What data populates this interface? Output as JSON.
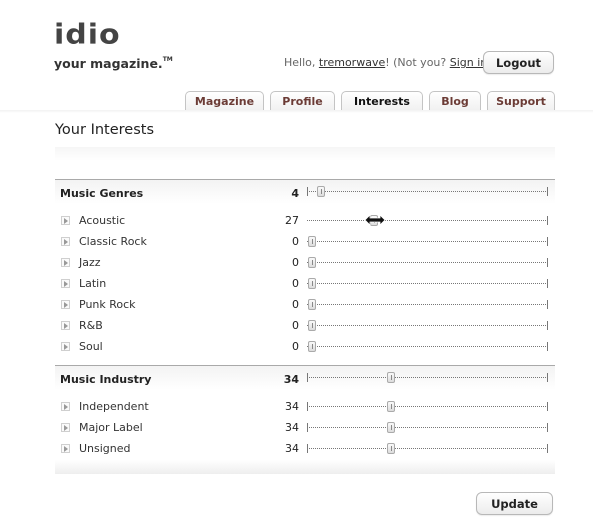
{
  "brand": {
    "wordmark": "idio",
    "tagline": "your magazine.",
    "trademark": "TM"
  },
  "header": {
    "greeting_prefix": "Hello, ",
    "username": "tremorwave",
    "greeting_mid": "! (Not you? ",
    "sign_in": "Sign in",
    "greeting_suffix": ".)",
    "logout_label": "Logout"
  },
  "tabs": [
    {
      "label": "Magazine",
      "active": false
    },
    {
      "label": "Profile",
      "active": false
    },
    {
      "label": "Interests",
      "active": true
    },
    {
      "label": "Blog",
      "active": false
    },
    {
      "label": "Support",
      "active": false
    }
  ],
  "page_title": "Your Interests",
  "sections": [
    {
      "name": "Music Genres",
      "count": "4",
      "level": 0.06,
      "items": [
        {
          "label": "Acoustic",
          "count": "27",
          "level": 0.28
        },
        {
          "label": "Classic Rock",
          "count": "0",
          "level": 0.02
        },
        {
          "label": "Jazz",
          "count": "0",
          "level": 0.02
        },
        {
          "label": "Latin",
          "count": "0",
          "level": 0.02
        },
        {
          "label": "Punk Rock",
          "count": "0",
          "level": 0.02
        },
        {
          "label": "R&B",
          "count": "0",
          "level": 0.02
        },
        {
          "label": "Soul",
          "count": "0",
          "level": 0.02
        }
      ]
    },
    {
      "name": "Music Industry",
      "count": "34",
      "level": 0.35,
      "items": [
        {
          "label": "Independent",
          "count": "34",
          "level": 0.35
        },
        {
          "label": "Major Label",
          "count": "34",
          "level": 0.35
        },
        {
          "label": "Unsigned",
          "count": "34",
          "level": 0.35
        }
      ]
    }
  ],
  "update_label": "Update",
  "cursor": {
    "icon": "resize-horizontal-cursor-icon"
  }
}
